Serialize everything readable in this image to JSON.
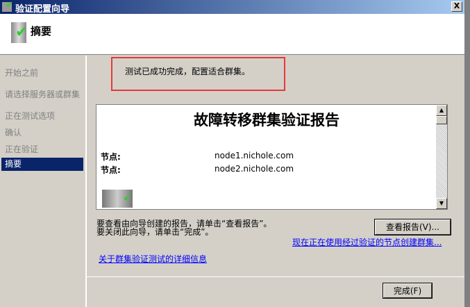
{
  "window": {
    "title": "验证配置向导",
    "close": "X"
  },
  "header": {
    "title": "摘要"
  },
  "nav": [
    "开始之前",
    "请选择服务器或群集",
    "正在测试选项",
    "确认",
    "正在验证",
    "摘要"
  ],
  "status": "测试已成功完成，配置适合群集。",
  "report": {
    "title": "故障转移群集验证报告",
    "nodes": [
      {
        "label": "节点:",
        "value": "node1.nichole.com"
      },
      {
        "label": "节点:",
        "value": "node2.nichole.com"
      }
    ]
  },
  "instructions": [
    "要查看由向导创建的报告，请单击“查看报告”。",
    "要关闭此向导，请单击“完成”。"
  ],
  "buttons": {
    "view_report": "查看报告(V)...",
    "finish": "完成(F)"
  },
  "links": {
    "create_cluster": "现在正在使用经过验证的节点创建群集...",
    "more_info": "关于群集验证测试的详细信息"
  }
}
